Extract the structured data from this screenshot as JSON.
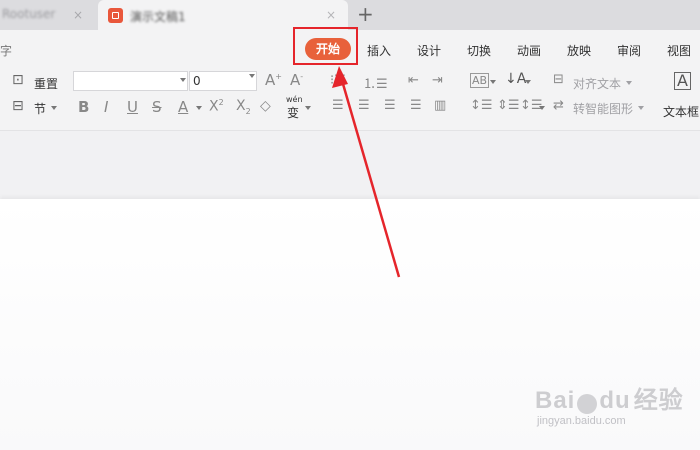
{
  "tabs": {
    "inactive_label": "Rootuser",
    "active_label": "演示文稿1",
    "close_symbol": "×",
    "new_tab_symbol": "+"
  },
  "menu": {
    "left_glyph": "字",
    "active_label": "开始",
    "items": [
      "插入",
      "设计",
      "切换",
      "动画",
      "放映",
      "审阅",
      "视图"
    ]
  },
  "ribbon": {
    "reset_label": "重置",
    "section_label": "节",
    "font_size_value": "0",
    "pinyin_label": "wén",
    "pinyin_char": "变",
    "align_text_label": "对齐文本",
    "smartart_label": "转智能图形",
    "textbox_label": "文本框"
  },
  "colors": {
    "accent": "#e8613b",
    "highlight_box": "#e5252b",
    "arrow": "#e5252b"
  },
  "watermark": {
    "brand_latin_1": "Bai",
    "brand_latin_2": "du",
    "brand_cn": "经验",
    "url": "jingyan.baidu.com"
  }
}
